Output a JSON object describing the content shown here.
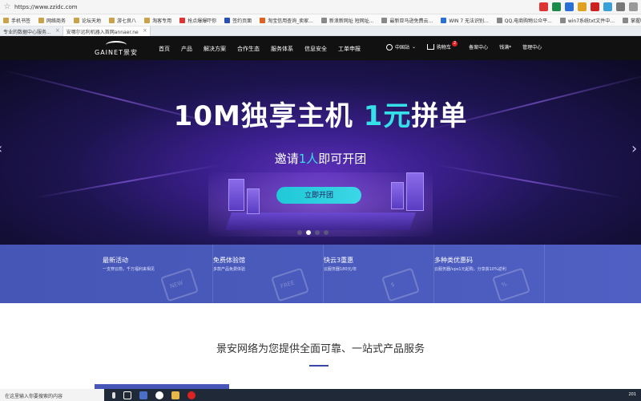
{
  "browser": {
    "url": "https://www.zzidc.com",
    "bookmarks": [
      "手机书签",
      "网络商务",
      "论坛天地",
      "游七良八",
      "淘客专用",
      "抢点爆爆吓你",
      "签约页面",
      "淘宝信用查询_卖家...",
      "新浪新网址 短网址...",
      "最新亚马逊免费云...",
      "WIN 7 无法识别...",
      "QQ,电商购物公众平...",
      "win7系统txt文件中...",
      "掌握吐露 - powere..."
    ],
    "tabs": [
      {
        "label": "专业的数据中心服务...",
        "active": false
      },
      {
        "label": "安哪尔远利机器入首网annaer.ne",
        "active": true
      }
    ]
  },
  "header": {
    "logo": "GAINET景安",
    "nav": [
      "首页",
      "产品",
      "解决方案",
      "合作生态",
      "服务体系",
      "信息安全",
      "工单申报"
    ],
    "right": {
      "region": "中国站",
      "cart": "购物车",
      "cart_count": "2",
      "console": "备案中心",
      "account": "钱满*",
      "admin": "管理中心"
    }
  },
  "hero": {
    "title_main": "10M独享主机",
    "title_highlight": "1元",
    "title_tail": "拼单",
    "sub_pre": "邀请",
    "sub_highlight": "1人",
    "sub_post": "即可开团",
    "cta": "立即开团",
    "slides": 4,
    "active_slide": 2
  },
  "promo": [
    {
      "title": "最新活动",
      "desc": "一支穿云箭，千万福利来相见",
      "deco": "NEW"
    },
    {
      "title": "免费体验馆",
      "desc": "多款产品免费体验",
      "deco": "FREE"
    },
    {
      "title": "快云3重惠",
      "desc": "云服务器180元/年",
      "deco": "$"
    },
    {
      "title": "多种类优惠码",
      "desc": "云服务器/vps1元起购，分享获10%返利",
      "deco": "%"
    }
  ],
  "section": {
    "title": "景安网络为您提供全面可靠、一站式产品服务"
  },
  "taskbar": {
    "search_placeholder": "在这里输入你要搜索的内容",
    "time": "201"
  },
  "colors": {
    "accent": "#35e0e8",
    "promo_bg": "#4656b6",
    "header_bg": "#111111"
  }
}
